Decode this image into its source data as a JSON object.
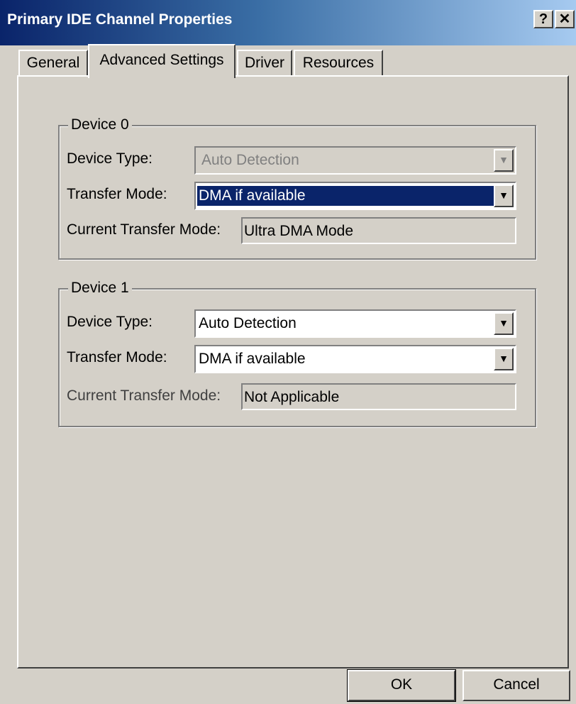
{
  "window": {
    "title": "Primary IDE Channel Properties",
    "help_glyph": "?",
    "close_glyph": "✕"
  },
  "tabs": [
    {
      "label": "General"
    },
    {
      "label": "Advanced Settings"
    },
    {
      "label": "Driver"
    },
    {
      "label": "Resources"
    }
  ],
  "device0": {
    "legend": "Device 0",
    "device_type_label": "Device Type:",
    "device_type_value": "Auto Detection",
    "transfer_mode_label": "Transfer Mode:",
    "transfer_mode_value": "DMA if available",
    "current_mode_label": "Current Transfer Mode:",
    "current_mode_value": "Ultra DMA Mode"
  },
  "device1": {
    "legend": "Device 1",
    "device_type_label": "Device Type:",
    "device_type_value": "Auto Detection",
    "transfer_mode_label": "Transfer Mode:",
    "transfer_mode_value": "DMA if available",
    "current_mode_label": "Current Transfer Mode:",
    "current_mode_value": "Not Applicable"
  },
  "buttons": {
    "ok": "OK",
    "cancel": "Cancel"
  },
  "icons": {
    "dropdown_arrow": "▼"
  },
  "colors": {
    "title_start": "#0a246a",
    "title_end": "#a6caf0",
    "face": "#d4d0c8",
    "selection": "#0a246a"
  }
}
